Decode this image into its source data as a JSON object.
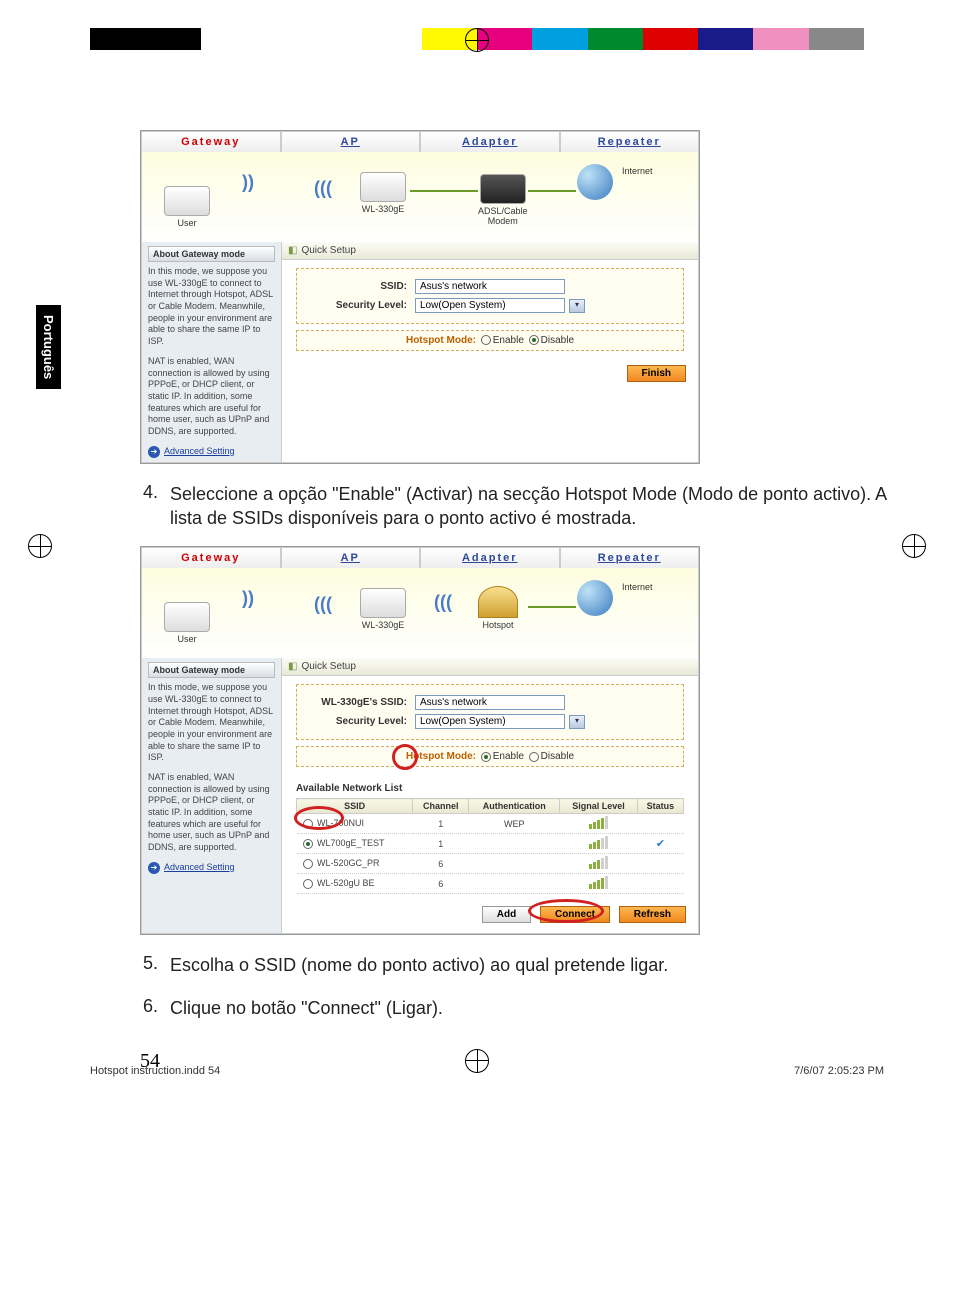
{
  "colorbar": [
    "#000",
    "#000",
    "#fff",
    "#fff",
    "#fff",
    "#fff",
    "#fff800",
    "#e6007e",
    "#00a0e0",
    "#008a2e",
    "#d00",
    "#1a1a8a",
    "#f090c0",
    "#888"
  ],
  "sideTab": "Português",
  "tabs": [
    "Gateway",
    "AP",
    "Adapter",
    "Repeater"
  ],
  "diagram1": {
    "user": "User",
    "router": "WL-330gE",
    "modem": "ADSL/Cable\nModem",
    "internet": "Internet"
  },
  "diagram2": {
    "user": "User",
    "router": "WL-330gE",
    "hotspot": "Hotspot",
    "internet": "Internet"
  },
  "sidebar": {
    "title": "About Gateway mode",
    "p1": "In this mode, we suppose you use WL-330gE to connect to Internet through Hotspot, ADSL or Cable Modem. Meanwhile, people in your environment are able to share the same IP to ISP.",
    "p2": "NAT is enabled, WAN connection is allowed by using PPPoE, or DHCP client, or static IP. In addition, some features which are useful for home user, such as UPnP and DDNS, are supported.",
    "link": "Advanced Setting"
  },
  "quickSetup": "Quick Setup",
  "form1": {
    "ssidLabel": "SSID:",
    "ssidValue": "Asus's network",
    "secLabel": "Security Level:",
    "secValue": "Low(Open System)",
    "hotspotLabel": "Hotspot Mode:",
    "enable": "Enable",
    "disable": "Disable",
    "finish": "Finish"
  },
  "form2": {
    "ssidLabel": "WL-330gE's SSID:",
    "ssidValue": "Asus's network",
    "secLabel": "Security Level:",
    "secValue": "Low(Open System)",
    "hotspotLabel": "Hotspot Mode:",
    "enable": "Enable",
    "disable": "Disable",
    "listHead": "Available Network List",
    "cols": [
      "SSID",
      "Channel",
      "Authentication",
      "Signal Level",
      "Status"
    ],
    "rows": [
      {
        "ssid": "WL-700NUI",
        "ch": "1",
        "auth": "WEP",
        "sig": 4,
        "status": ""
      },
      {
        "ssid": "WL700gE_TEST",
        "ch": "1",
        "auth": "",
        "sig": 3,
        "status": "✓",
        "sel": true
      },
      {
        "ssid": "WL-520GC_PR",
        "ch": "6",
        "auth": "",
        "sig": 3,
        "status": ""
      },
      {
        "ssid": "WL-520gU BE",
        "ch": "6",
        "auth": "",
        "sig": 4,
        "status": ""
      }
    ],
    "add": "Add",
    "connect": "Connect",
    "refresh": "Refresh"
  },
  "step4": {
    "num": "4.",
    "text": "Seleccione a opção \"Enable\" (Activar) na secção Hotspot Mode (Modo de ponto activo). A lista de SSIDs disponíveis para o ponto activo é mostrada."
  },
  "step5": {
    "num": "5.",
    "text": "Escolha o SSID (nome do ponto activo) ao qual pretende ligar."
  },
  "step6": {
    "num": "6.",
    "text": "Clique no botão \"Connect\" (Ligar)."
  },
  "pageNum": "54",
  "footer": {
    "left": "Hotspot instruction.indd   54",
    "right": "7/6/07   2:05:23 PM"
  }
}
